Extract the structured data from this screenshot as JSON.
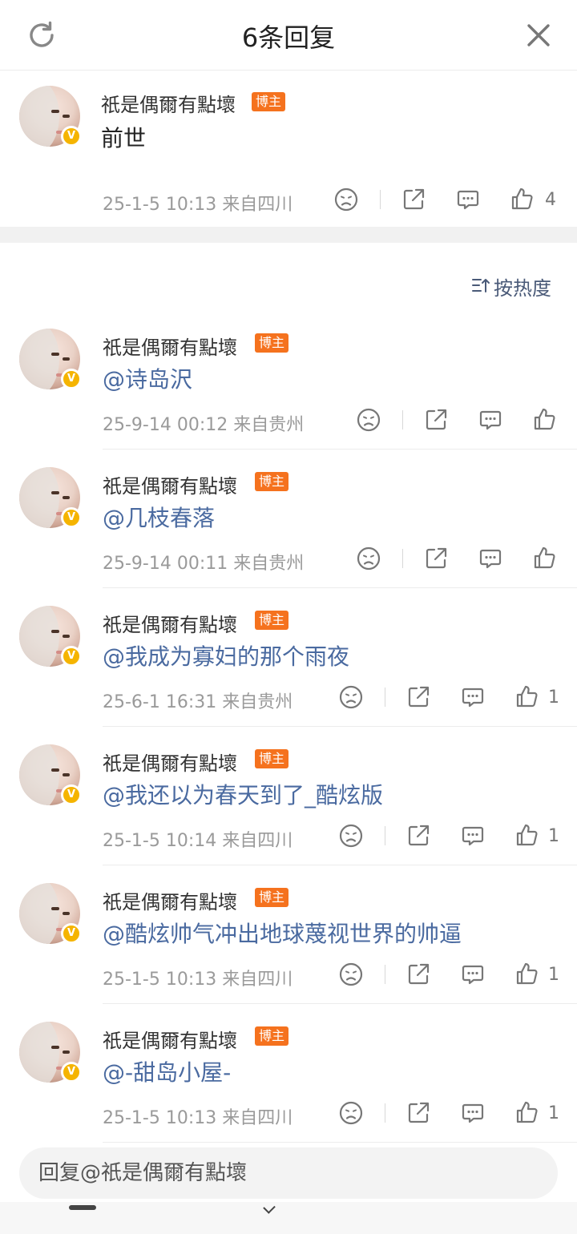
{
  "header": {
    "title": "6条回复",
    "refresh_icon": "refresh-icon",
    "close_icon": "close-icon"
  },
  "root_comment": {
    "author": "祇是偶爾有點壞",
    "badge": "博主",
    "text": "前世",
    "meta": "25-1-5 10:13  来自四川",
    "likes": "4"
  },
  "sort": {
    "label": "按热度",
    "icon": "sort-icon"
  },
  "replies": [
    {
      "author": "祇是偶爾有點壞",
      "badge": "博主",
      "text": "@诗岛沢",
      "meta": "25-9-14 00:12  来自贵州",
      "likes": ""
    },
    {
      "author": "祇是偶爾有點壞",
      "badge": "博主",
      "text": "@几枝春落",
      "meta": "25-9-14 00:11  来自贵州",
      "likes": ""
    },
    {
      "author": "祇是偶爾有點壞",
      "badge": "博主",
      "text": "@我成为寡妇的那个雨夜",
      "meta": "25-6-1 16:31  来自贵州",
      "likes": "1"
    },
    {
      "author": "祇是偶爾有點壞",
      "badge": "博主",
      "text": "@我还以为春天到了_酷炫版",
      "meta": "25-1-5 10:14  来自四川",
      "likes": "1"
    },
    {
      "author": "祇是偶爾有點壞",
      "badge": "博主",
      "text": "@酷炫帅气冲出地球蔑视世界的帅逼",
      "meta": "25-1-5 10:13  来自四川",
      "likes": "1"
    },
    {
      "author": "祇是偶爾有點壞",
      "badge": "博主",
      "text": "@-甜岛小屋-",
      "meta": "25-1-5 10:13  来自四川",
      "likes": "1"
    }
  ],
  "composer": {
    "placeholder": "回复@祇是偶爾有點壞"
  },
  "colors": {
    "badge": "#f5721e",
    "verified": "#f5b400",
    "mention": "#4a6aa0"
  }
}
